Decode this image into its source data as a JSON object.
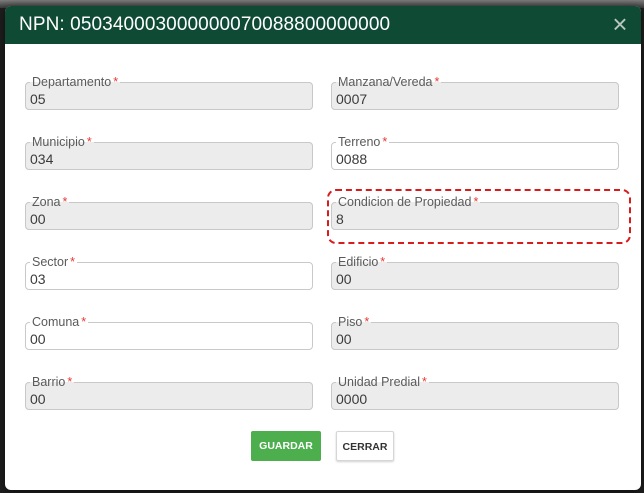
{
  "dialog": {
    "title": "NPN: 05034000300000007008880000000​0",
    "close_icon": "×"
  },
  "required_mark": "*",
  "fields": {
    "departamento": {
      "label": "Departamento",
      "value": "05"
    },
    "manzana_vereda": {
      "label": "Manzana/Vereda",
      "value": "0007"
    },
    "municipio": {
      "label": "Municipio",
      "value": "034"
    },
    "terreno": {
      "label": "Terreno",
      "value": "0088"
    },
    "zona": {
      "label": "Zona",
      "value": "00"
    },
    "condicion_propiedad": {
      "label": "Condicion de Propiedad",
      "value": "8"
    },
    "sector": {
      "label": "Sector",
      "value": "03"
    },
    "edificio": {
      "label": "Edificio",
      "value": "00"
    },
    "comuna": {
      "label": "Comuna",
      "value": "00"
    },
    "piso": {
      "label": "Piso",
      "value": "00"
    },
    "barrio": {
      "label": "Barrio",
      "value": "00"
    },
    "unidad_predial": {
      "label": "Unidad Predial",
      "value": "0000"
    }
  },
  "buttons": {
    "save_label": "GUARDAR",
    "close_label": "CERRAR"
  },
  "colors": {
    "header_bg": "#0f4a35",
    "save_bg": "#4cae4c",
    "required": "#e53935",
    "highlight": "#d81b1b"
  }
}
